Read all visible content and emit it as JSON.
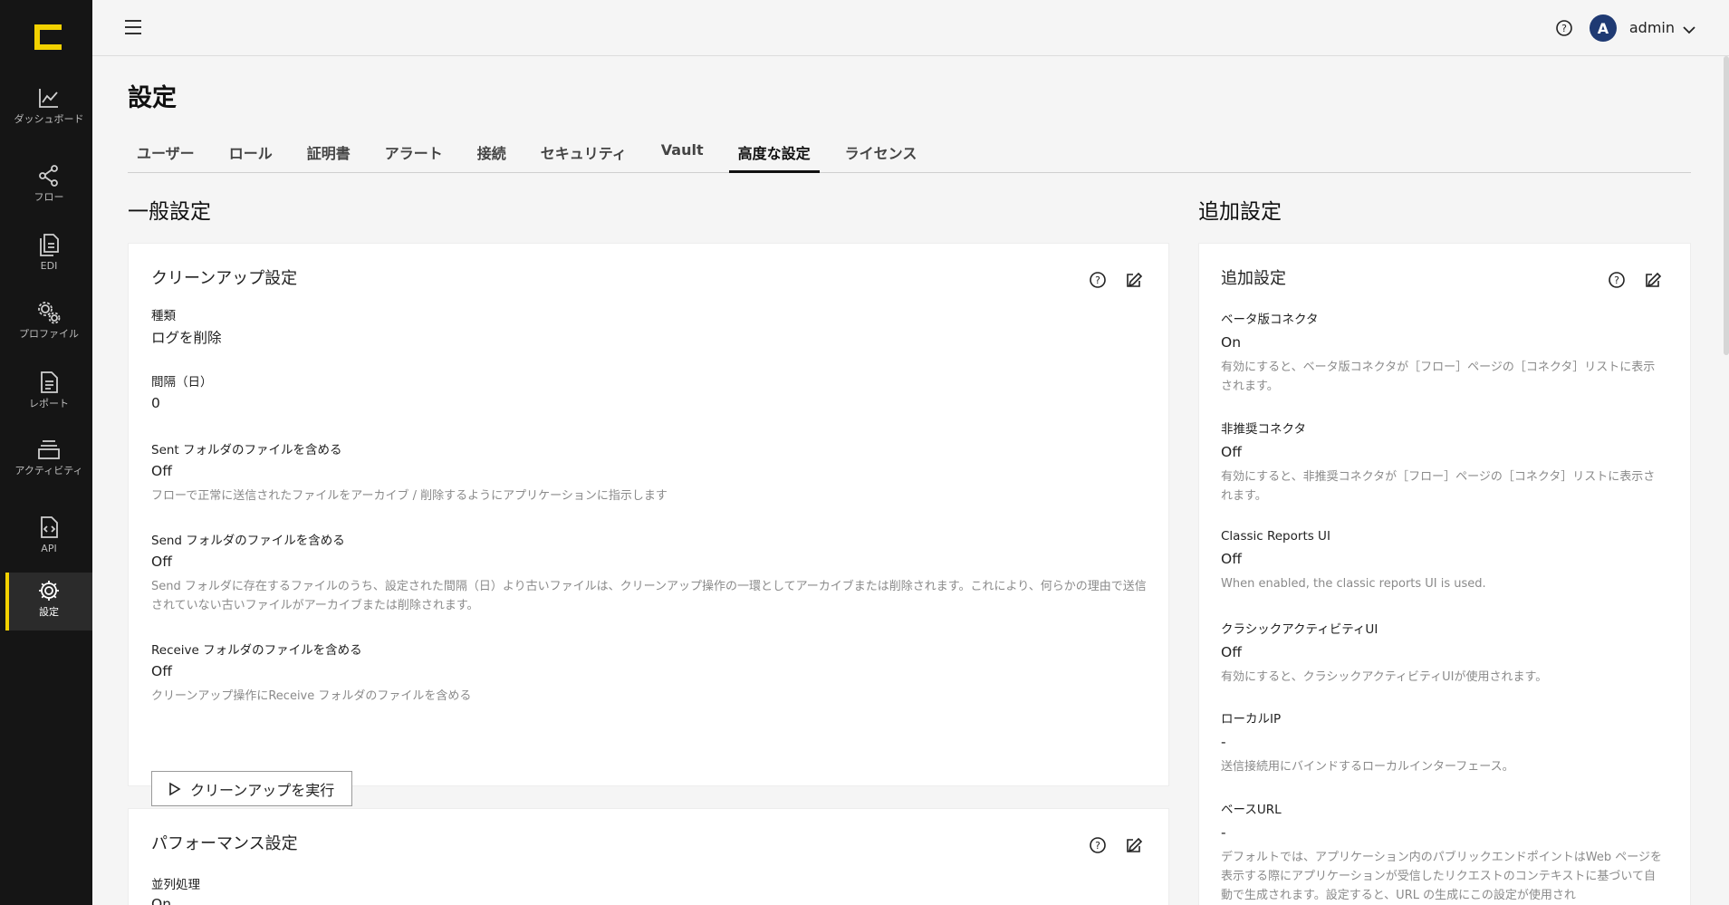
{
  "sidebar": {
    "items": [
      {
        "label": "ダッシュボード",
        "icon": "chart-line-icon"
      },
      {
        "label": "フロー",
        "icon": "share-nodes-icon"
      },
      {
        "label": "EDI",
        "icon": "documents-icon"
      },
      {
        "label": "プロファイル",
        "icon": "gears-icon"
      },
      {
        "label": "レポート",
        "icon": "report-icon"
      },
      {
        "label": "アクティビティ",
        "icon": "layers-icon"
      },
      {
        "label": "API",
        "icon": "code-file-icon"
      },
      {
        "label": "設定",
        "icon": "gear-icon"
      }
    ]
  },
  "header": {
    "user_initial": "A",
    "user_name": "admin"
  },
  "page": {
    "title": "設定",
    "tabs": [
      "ユーザー",
      "ロール",
      "証明書",
      "アラート",
      "接続",
      "セキュリティ",
      "Vault",
      "高度な設定",
      "ライセンス"
    ],
    "active_tab": "高度な設定"
  },
  "general": {
    "section_title": "一般設定",
    "cleanup": {
      "title": "クリーンアップ設定",
      "type_label": "種類",
      "type_value": "ログを削除",
      "interval_label": "間隔（日）",
      "interval_value": "0",
      "sent_label": "Sent フォルダのファイルを含める",
      "sent_value": "Off",
      "sent_desc": "フローで正常に送信されたファイルをアーカイブ / 削除するようにアプリケーションに指示します",
      "send_label": "Send フォルダのファイルを含める",
      "send_value": "Off",
      "send_desc": "Send フォルダに存在するファイルのうち、設定された間隔（日）より古いファイルは、クリーンアップ操作の一環としてアーカイブまたは削除されます。これにより、何らかの理由で送信されていない古いファイルがアーカイブまたは削除されます。",
      "receive_label": "Receive フォルダのファイルを含める",
      "receive_value": "Off",
      "receive_desc": "クリーンアップ操作にReceive フォルダのファイルを含める",
      "run_button": "クリーンアップを実行"
    },
    "performance": {
      "title": "パフォーマンス設定",
      "parallel_label": "並列処理",
      "parallel_value": "On"
    }
  },
  "additional": {
    "section_title": "追加設定",
    "card_title": "追加設定",
    "fields": [
      {
        "label": "ベータ版コネクタ",
        "value": "On",
        "desc": "有効にすると、ベータ版コネクタが［フロー］ページの［コネクタ］リストに表示されます。"
      },
      {
        "label": "非推奨コネクタ",
        "value": "Off",
        "desc": "有効にすると、非推奨コネクタが［フロー］ページの［コネクタ］リストに表示されます。"
      },
      {
        "label": "Classic Reports UI",
        "value": "Off",
        "desc": "When enabled, the classic reports UI is used."
      },
      {
        "label": "クラシックアクティビティUI",
        "value": "Off",
        "desc": "有効にすると、クラシックアクティビティUIが使用されます。"
      },
      {
        "label": "ローカルIP",
        "value": "-",
        "desc": "送信接続用にバインドするローカルインターフェース。"
      },
      {
        "label": "ベースURL",
        "value": "-",
        "desc": "デフォルトでは、アプリケーション内のパブリックエンドポイントはWeb ページを表示する際にアプリケーションが受信したリクエストのコンテキストに基づいて自動で生成されます。設定すると、URL の生成にこの設定が使用され"
      }
    ]
  }
}
